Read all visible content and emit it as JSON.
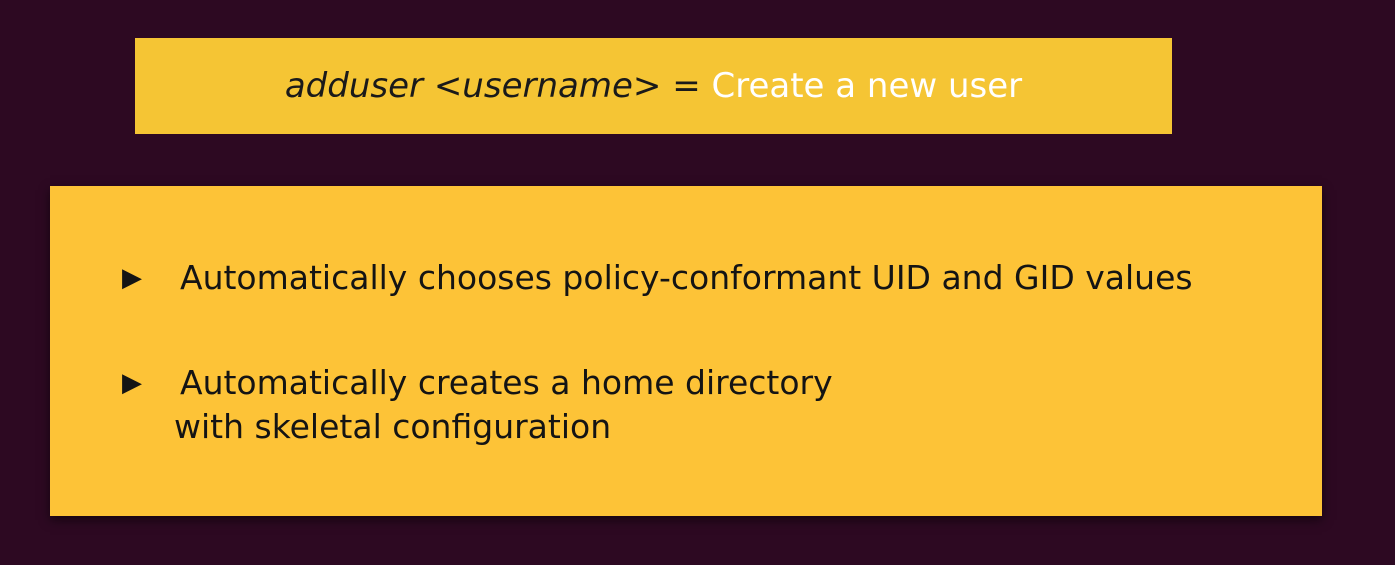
{
  "header": {
    "command": "adduser",
    "argument": "<username>",
    "equals": "=",
    "description": "Create a new user"
  },
  "bullets": [
    {
      "marker": "▶",
      "line1": "Automatically chooses policy-conformant UID and GID values"
    },
    {
      "marker": "▶",
      "line1": "Automatically creates a home directory",
      "line2": "with skeletal configuration"
    }
  ],
  "colors": {
    "background": "#2d0922",
    "title_bar": "#f5c534",
    "content_box": "#fdc337",
    "description_text": "#ffffff"
  }
}
